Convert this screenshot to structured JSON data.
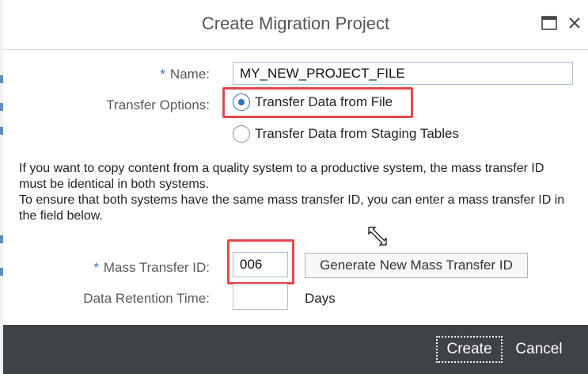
{
  "dialog": {
    "title": "Create Migration Project"
  },
  "form": {
    "name": {
      "required_mark": "*",
      "label": "Name:",
      "value": "MY_NEW_PROJECT_FILE"
    },
    "transfer_options": {
      "label": "Transfer Options:",
      "options": [
        {
          "label": "Transfer Data from File",
          "selected": true
        },
        {
          "label": "Transfer Data from Staging Tables",
          "selected": false
        }
      ]
    },
    "info": {
      "line1": "If you want to copy content from a quality system to a productive system, the mass transfer ID must be identical in both systems.",
      "line2": "To ensure that both systems have the same mass transfer ID, you can enter a mass transfer ID in the field below."
    },
    "mass_transfer": {
      "required_mark": "*",
      "label": "Mass Transfer ID:",
      "value": "006",
      "generate_label": "Generate New Mass Transfer ID"
    },
    "retention": {
      "label": "Data Retention Time:",
      "value": "",
      "unit": "Days"
    }
  },
  "footer": {
    "create_label": "Create",
    "cancel_label": "Cancel"
  },
  "colors": {
    "accent": "#2f6fb4",
    "highlight": "#e5484d",
    "footer_bg": "#3f4347"
  }
}
